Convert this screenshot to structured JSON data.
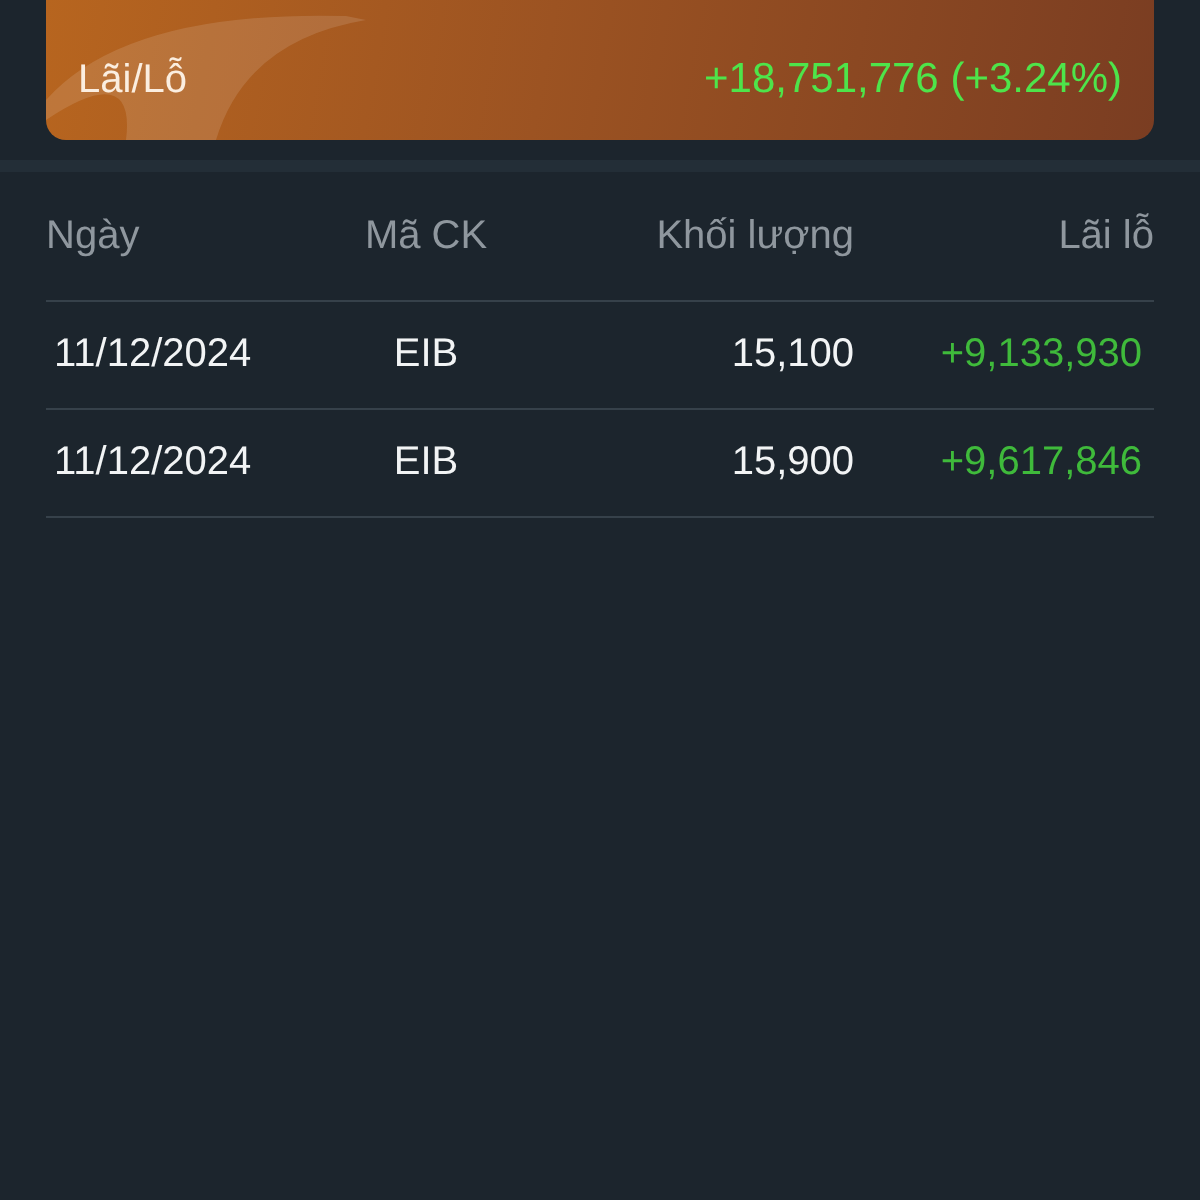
{
  "summary_card": {
    "label": "Lãi/Lỗ",
    "value": "+18,751,776 (+3.24%)"
  },
  "table": {
    "columns": [
      "Ngày",
      "Mã CK",
      "Khối lượng",
      "Lãi lỗ"
    ],
    "rows": [
      {
        "date": "11/12/2024",
        "symbol": "EIB",
        "volume": "15,100",
        "profit": "+9,133,930"
      },
      {
        "date": "11/12/2024",
        "symbol": "EIB",
        "volume": "15,900",
        "profit": "+9,617,846"
      }
    ]
  }
}
